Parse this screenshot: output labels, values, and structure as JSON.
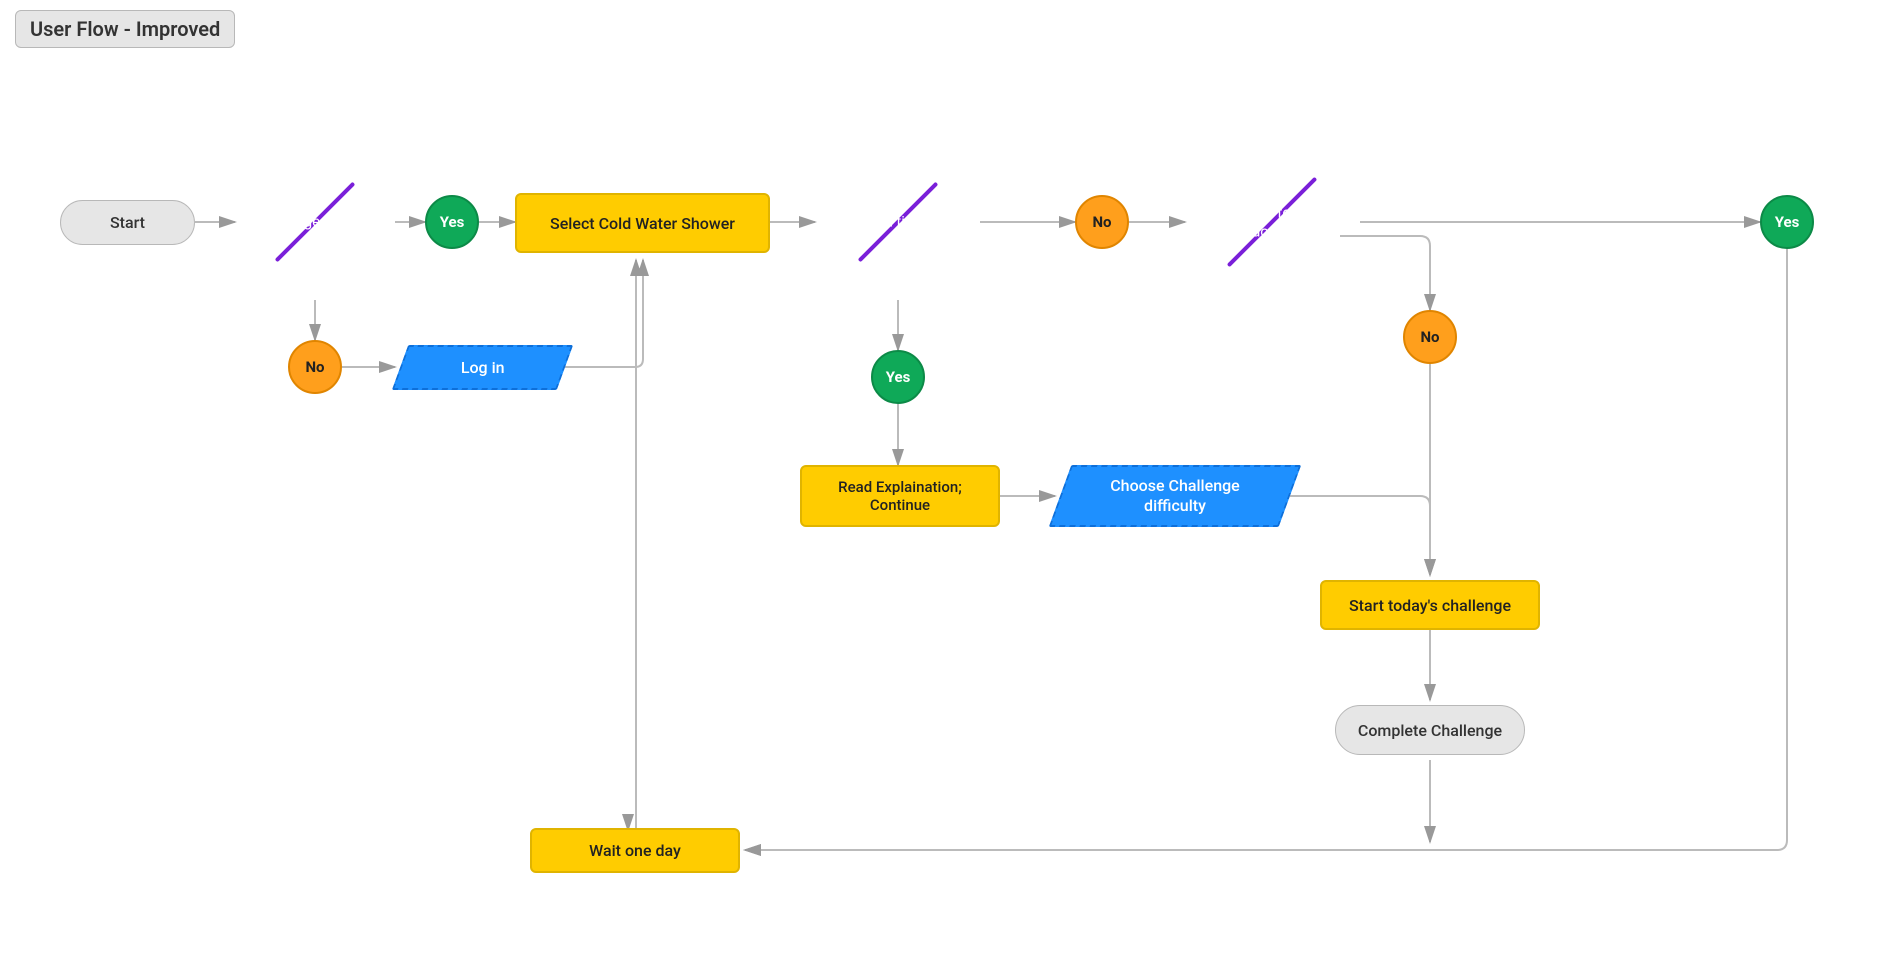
{
  "title": "User Flow - Improved",
  "nodes": {
    "start": "Start",
    "logged_in": "Logged in?",
    "logged_in_yes": "Yes",
    "logged_in_no": "No",
    "login": "Log in",
    "select_shower": "Select Cold Water Shower",
    "first_time": "First time?",
    "first_time_yes": "Yes",
    "first_time_no": "No",
    "challenge_done": "Challenge for today done?",
    "challenge_done_yes": "Yes",
    "challenge_done_no": "No",
    "read_explanation": "Read Explaination; Continue",
    "choose_difficulty": "Choose Challenge difficulty",
    "start_challenge": "Start today's challenge",
    "complete_challenge": "Complete Challenge",
    "wait_one_day": "Wait one day"
  },
  "colors": {
    "purple": "#9b30ff",
    "green": "#0fa958",
    "orange": "#ff9f1c",
    "yellow": "#ffcc00",
    "blue": "#1e90ff",
    "grey": "#e6e6e6"
  }
}
